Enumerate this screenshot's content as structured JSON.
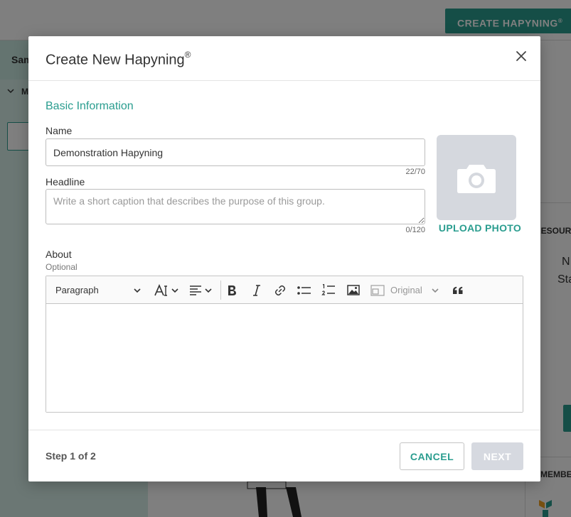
{
  "background": {
    "create_button_label": "CREATE HAPYNING",
    "create_button_mark": "®",
    "left_panel_text": "Sam",
    "left_section_text": "M",
    "right_section_text": "RESOURC",
    "right_text_1": "N",
    "right_text_2": "Sta",
    "right_section_text_2": "MEMBER"
  },
  "modal": {
    "title": "Create New Hapyning",
    "title_mark": "®",
    "close_icon": "close-icon",
    "section_title": "Basic Information",
    "name": {
      "label": "Name",
      "value": "Demonstration Hapyning",
      "counter": "22/70"
    },
    "headline": {
      "label": "Headline",
      "value": "",
      "placeholder": "Write a short caption that describes the purpose of this group.",
      "counter": "0/120"
    },
    "photo": {
      "icon": "camera-icon",
      "upload_label": "UPLOAD PHOTO"
    },
    "about": {
      "label": "About",
      "optional_text": "Optional",
      "toolbar": {
        "paragraph_label": "Paragraph",
        "image_size_label": "Original",
        "icons": [
          "font-size-icon",
          "align-icon",
          "bold-icon",
          "italic-icon",
          "link-icon",
          "bulleted-list-icon",
          "numbered-list-icon",
          "image-icon",
          "image-resize-icon",
          "blockquote-icon"
        ]
      }
    },
    "footer": {
      "step_text": "Step 1 of 2",
      "cancel_label": "CANCEL",
      "next_label": "NEXT"
    }
  },
  "colors": {
    "accent": "#2a9d8f",
    "disabled_button": "#d6d9e0",
    "photo_placeholder": "#d5d8de"
  }
}
